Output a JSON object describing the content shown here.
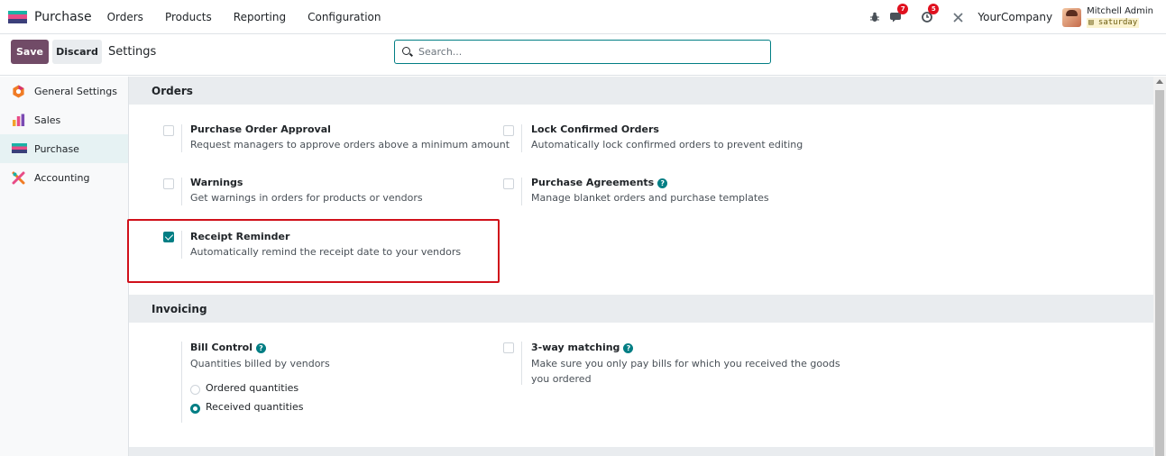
{
  "navbar": {
    "app_name": "Purchase",
    "menu": [
      "Orders",
      "Products",
      "Reporting",
      "Configuration"
    ],
    "messages_count": "7",
    "activities_count": "5",
    "company": "YourCompany",
    "user_name": "Mitchell Admin",
    "db_name": "saturday"
  },
  "controlbar": {
    "save_label": "Save",
    "discard_label": "Discard",
    "breadcrumb": "Settings",
    "search_placeholder": "Search..."
  },
  "sidebar": {
    "items": [
      {
        "label": "General Settings",
        "icon": "general-settings-icon"
      },
      {
        "label": "Sales",
        "icon": "sales-icon"
      },
      {
        "label": "Purchase",
        "icon": "purchase-icon",
        "active": true
      },
      {
        "label": "Accounting",
        "icon": "accounting-icon"
      }
    ]
  },
  "orders": {
    "heading": "Orders",
    "settings": [
      {
        "title": "Purchase Order Approval",
        "desc": "Request managers to approve orders above a minimum amount",
        "checked": false
      },
      {
        "title": "Lock Confirmed Orders",
        "desc": "Automatically lock confirmed orders to prevent editing",
        "checked": false
      },
      {
        "title": "Warnings",
        "desc": "Get warnings in orders for products or vendors",
        "checked": false
      },
      {
        "title": "Purchase Agreements",
        "desc": "Manage blanket orders and purchase templates",
        "checked": false
      },
      {
        "title": "Receipt Reminder",
        "desc": "Automatically remind the receipt date to your vendors",
        "checked": true
      }
    ]
  },
  "invoicing": {
    "heading": "Invoicing",
    "bill_control": {
      "title": "Bill Control",
      "desc": "Quantities billed by vendors",
      "options": [
        "Ordered quantities",
        "Received quantities"
      ],
      "selected": "Received quantities"
    },
    "three_way": {
      "title": "3-way matching",
      "desc_line1": "Make sure you only pay bills for which you received the goods",
      "desc_line2": "you ordered",
      "checked": false
    }
  },
  "colors": {
    "brand": "#714b67",
    "accent": "#017e84",
    "highlight_border": "#d0101a"
  }
}
